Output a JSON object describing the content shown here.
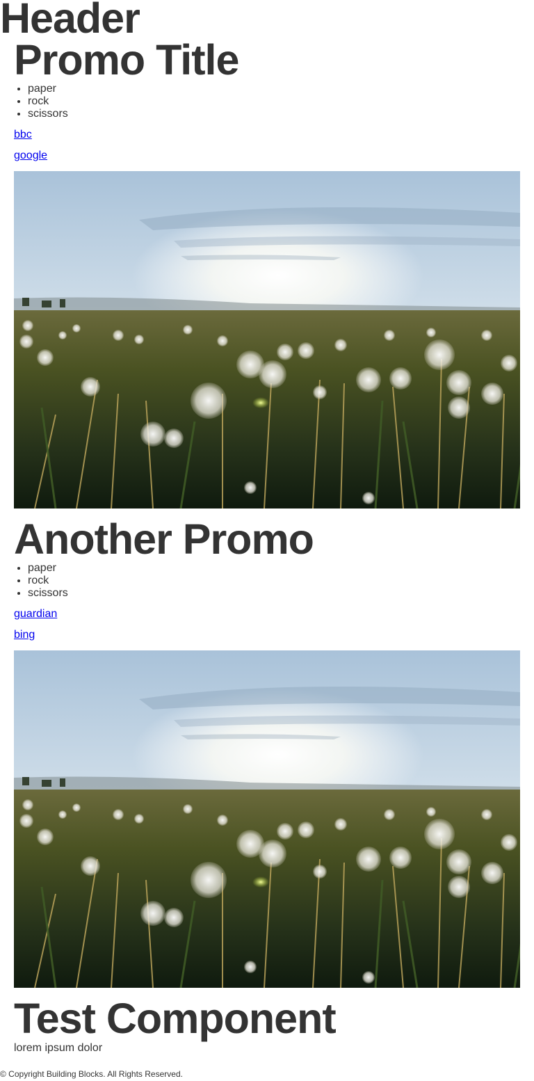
{
  "header": {
    "title": "Header"
  },
  "promos": [
    {
      "title": "Promo Title",
      "list": [
        "paper",
        "rock",
        "scissors"
      ],
      "links": [
        "bbc",
        "google"
      ],
      "image": "dandelion-field-sunset-photo"
    },
    {
      "title": "Another Promo",
      "list": [
        "paper",
        "rock",
        "scissors"
      ],
      "links": [
        "guardian",
        "bing"
      ],
      "image": "dandelion-field-sunset-photo"
    }
  ],
  "test_component": {
    "title": "Test Component",
    "body": "lorem ipsum dolor"
  },
  "footer": {
    "text": "© Copyright Building Blocks. All Rights Reserved."
  },
  "colors": {
    "text": "#333333",
    "link": "#0000ee",
    "background": "#ffffff"
  }
}
